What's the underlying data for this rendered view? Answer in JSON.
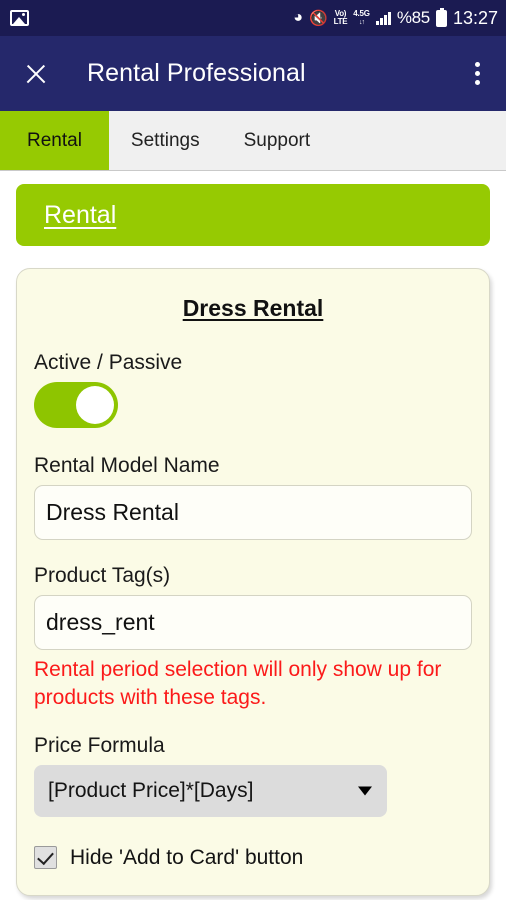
{
  "status_bar": {
    "notification_icon": "image-icon",
    "bluetooth_icon": "bluetooth-icon",
    "mute_icon": "volume-mute-icon",
    "volte_line1": "Vo)",
    "volte_line2": "LTE",
    "network_type": "4.5G",
    "network_arrows": "↓↑",
    "signal_icon": "signal-bars-icon",
    "battery_percent": "%85",
    "battery_icon": "battery-icon",
    "time": "13:27"
  },
  "app_bar": {
    "close_icon": "close-icon",
    "title": "Rental Professional",
    "overflow_icon": "more-vertical-icon"
  },
  "tabs": [
    {
      "label": "Rental",
      "active": true
    },
    {
      "label": "Settings",
      "active": false
    },
    {
      "label": "Support",
      "active": false
    }
  ],
  "section_banner": {
    "label": "Rental"
  },
  "card": {
    "title": "Dress Rental",
    "active_passive": {
      "label": "Active / Passive",
      "value": "on"
    },
    "rental_model_name": {
      "label": "Rental Model Name",
      "value": "Dress Rental",
      "placeholder": "Rental Model Name"
    },
    "product_tags": {
      "label": "Product Tag(s)",
      "value": "dress_rent",
      "placeholder": "Product Tag(s)"
    },
    "warning": "Rental period selection will only show up for products with these tags.",
    "price_formula": {
      "label": "Price Formula",
      "selected": "[Product Price]*[Days]",
      "arrow_icon": "chevron-down-icon"
    },
    "hide_add_to_card": {
      "label": "Hide 'Add to Card' button",
      "checked": true
    }
  },
  "colors": {
    "status_bar_bg": "#1b1b52",
    "app_bar_bg": "#25286b",
    "accent_green": "#96ca02",
    "toggle_green": "#8ec500",
    "card_bg": "#fbfbe6",
    "warning_red": "#fb1a1a",
    "tab_bar_bg": "#f0f0f0",
    "select_bg": "#dcdcdc"
  }
}
